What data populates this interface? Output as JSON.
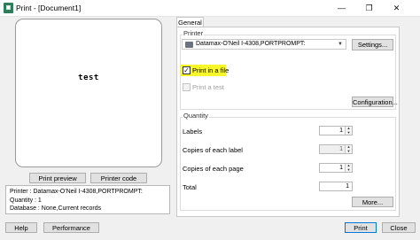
{
  "window": {
    "title": "Print - [Document1]",
    "minimize": "—",
    "restore": "❐",
    "close": "✕"
  },
  "preview": {
    "text": "test",
    "print_preview_label": "Print preview",
    "printer_code_label": "Printer code"
  },
  "info": {
    "lines": [
      "Printer : Datamax-O'Neil I-4308,PORTPROMPT:",
      "Quantity : 1",
      "Database : None,Current records"
    ]
  },
  "tabs": {
    "general": "General"
  },
  "printer_group": {
    "label": "Printer",
    "selected_printer": "Datamax-O'Neil I-4308,PORTPROMPT:",
    "settings_label": "Settings...",
    "print_to_file_label": "Print in a file",
    "print_to_file_checked": true,
    "print_test_label": "Print a test",
    "print_test_checked": false,
    "configuration_label": "Configuration..."
  },
  "quantity_group": {
    "label": "Quantity",
    "labels_label": "Labels",
    "labels_value": "1",
    "copies_label_label": "Copies of each label",
    "copies_label_value": "1",
    "copies_page_label": "Copies of each page",
    "copies_page_value": "1",
    "total_label": "Total",
    "total_value": "1",
    "more_label": "More..."
  },
  "footer": {
    "help_label": "Help",
    "performance_label": "Performance",
    "print_label": "Print",
    "close_label": "Close"
  },
  "colors": {
    "accent": "#0078d7",
    "highlight": "#f7f72a"
  }
}
